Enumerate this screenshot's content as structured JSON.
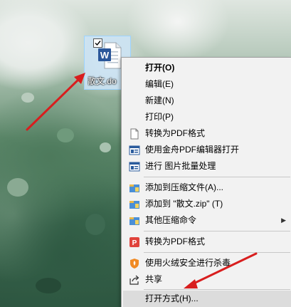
{
  "file": {
    "label": "散文.do",
    "icon": "word-document-icon",
    "accent": "#2b579a"
  },
  "menu": {
    "open": "打开(O)",
    "edit": "编辑(E)",
    "new": "新建(N)",
    "print": "打印(P)",
    "convert_pdf_1": "转换为PDF格式",
    "open_jinzhou_pdf": "使用金舟PDF编辑器打开",
    "batch_image": "进行 图片批量处理",
    "add_archive": "添加到压缩文件(A)...",
    "add_zip": "添加到 \"散文.zip\" (T)",
    "other_compress": "其他压缩命令",
    "convert_pdf_2": "转换为PDF格式",
    "huorong_scan": "使用火绒安全进行杀毒",
    "share": "共享",
    "open_with": "打开方式(H)..."
  },
  "annotation": {
    "arrow_color": "#d81e1e"
  }
}
